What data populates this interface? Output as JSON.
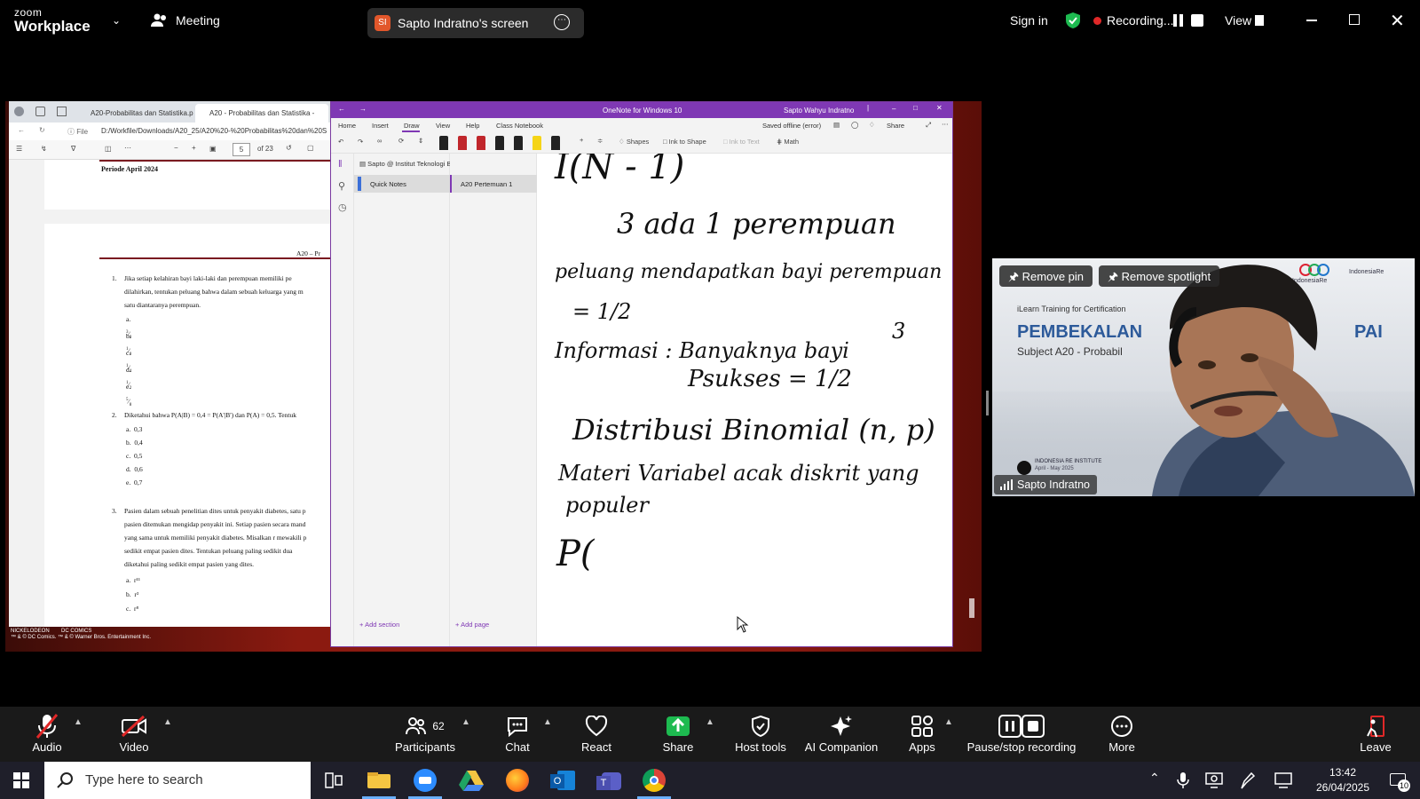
{
  "zoom": {
    "brand_top": "zoom",
    "brand_bottom": "Workplace",
    "meeting_label": "Meeting",
    "share_badge": "SI",
    "share_title": "Sapto Indratno's screen",
    "sign_in": "Sign in",
    "recording": "Recording...",
    "view": "View"
  },
  "pdf": {
    "tabs": [
      "A20-Probabilitas dan Statistika.pd",
      "A20 - Probabilitas dan Statistika -"
    ],
    "address_prefix": "File",
    "address": "D:/Workfile/Downloads/A20_25/A20%20-%20Probabilitas%20dan%20S",
    "page_current": "5",
    "page_total": "of 23",
    "period": "Periode April 2024",
    "header_right": "A20 – Pr",
    "q1": {
      "num": "1.",
      "lines": [
        "Jika setiap kelahiran bayi laki-laki dan perempuan memiliki pe",
        "dilahirkan, tentukan peluang bahwa dalam sebuah keluarga yang m",
        "satu diantaranya perempuan."
      ],
      "options": [
        {
          "l": "a.",
          "n": "3",
          "d": "8"
        },
        {
          "l": "b.",
          "n": "1",
          "d": "8"
        },
        {
          "l": "c.",
          "n": "1",
          "d": "4"
        },
        {
          "l": "d.",
          "n": "1",
          "d": "2"
        },
        {
          "l": "e.",
          "n": "5",
          "d": "8"
        }
      ]
    },
    "q2": {
      "num": "2.",
      "line": "Diketahui bahwa P(A|B) = 0,4 = P(A'|B') dan P(A) = 0,5. Tentuk",
      "options": [
        {
          "l": "a.",
          "v": "0,3"
        },
        {
          "l": "b.",
          "v": "0,4"
        },
        {
          "l": "c.",
          "v": "0,5"
        },
        {
          "l": "d.",
          "v": "0,6"
        },
        {
          "l": "e.",
          "v": "0,7"
        }
      ]
    },
    "q3": {
      "num": "3.",
      "lines": [
        "Pasien dalam sebuah penelitian dites untuk penyakit diabetes, satu p",
        "pasien ditemukan mengidap penyakit ini. Setiap pasien secara mand",
        "yang sama untuk memiliki penyakit diabetes. Misalkan r mewakili p",
        "sedikit empat pasien dites. Tentukan peluang paling sedikit dua",
        "diketahui paling sedikit empat pasien yang dites."
      ],
      "options": [
        {
          "l": "a.",
          "v": "r¹¹"
        },
        {
          "l": "b.",
          "v": "r³"
        },
        {
          "l": "c.",
          "v": "r⁸"
        }
      ]
    },
    "footer": [
      "NICKELODEON",
      "DC COMICS",
      "™ & © DC Comics. ™ & © Warner Bros. Entertainment Inc."
    ]
  },
  "onenote": {
    "title": "OneNote for Windows 10",
    "user": "Sapto Wahyu Indratno",
    "menu": [
      "Home",
      "Insert",
      "Draw",
      "View",
      "Help",
      "Class Notebook"
    ],
    "active_menu": "Draw",
    "saved": "Saved offline (error)",
    "share": "Share",
    "tools": {
      "shapes": "Shapes",
      "ink_to_shape": "Ink to Shape",
      "ink_to_text": "Ink to Text",
      "math": "Math"
    },
    "notebook": "Sapto @ Institut Teknologi Bandung",
    "section": "Quick Notes",
    "page": "A20 Pertemuan 1",
    "add_section": "Add section",
    "add_page": "Add page",
    "pen_colors": [
      "#222222",
      "#c0262b",
      "#c0262b",
      "#222222",
      "#222222",
      "#f5d416",
      "#222222"
    ],
    "ink": {
      "l1": "I(N - 1)",
      "l2": "3 ada 1 perempuan",
      "l3": "peluang mendapatkan bayi perempuan",
      "l4": "= 1/2",
      "l5a": "Informasi : Banyaknya bayi",
      "l5b": "3",
      "l6": "Psukses = 1/2",
      "l7": "Distribusi Binomial (n, p)",
      "l8": "Materi Variabel acak diskrit yang",
      "l9": "populer",
      "l10": "P("
    }
  },
  "video": {
    "remove_pin": "Remove pin",
    "remove_spotlight": "Remove spotlight",
    "slide_sub": "iLearn Training for Certification",
    "slide_title_a": "PEMBEKALAN",
    "slide_title_b": "PAI",
    "slide_subject": "Subject A20 - Probabil",
    "logo1": "IndonesiaRe",
    "logo2": "IndonesiaRe",
    "institute": "INDONESIA RE INSTITUTE",
    "institute_date": "April - May 2025",
    "name": "Sapto Indratno"
  },
  "toolbar": {
    "audio": "Audio",
    "video": "Video",
    "participants": "Participants",
    "participants_count": "62",
    "chat": "Chat",
    "react": "React",
    "share": "Share",
    "host_tools": "Host tools",
    "ai_companion": "AI Companion",
    "apps": "Apps",
    "pause_stop": "Pause/stop recording",
    "more": "More",
    "leave": "Leave"
  },
  "taskbar": {
    "search_placeholder": "Type here to search",
    "time": "13:42",
    "date": "26/04/2025",
    "notif_count": "10"
  },
  "colors": {
    "onenote_purple": "#7f38b4",
    "zoom_share_green": "#1dba50",
    "recording_red": "#e02828",
    "leave_red": "#e02828"
  }
}
